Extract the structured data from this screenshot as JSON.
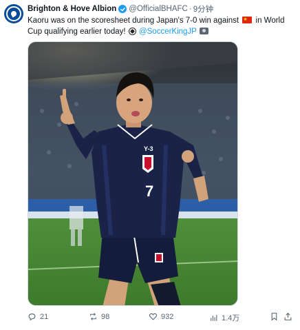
{
  "author": {
    "name": "Brighton & Hove Albion",
    "handle": "@OfficialBHAFC",
    "separator": "·",
    "time": "9分钟",
    "verified": true,
    "avatar_color": "#0a4c9a"
  },
  "tweet": {
    "text_part1": "Kaoru was on the scoresheet during Japan's 7-0 win against ",
    "flag": "china-flag",
    "text_part2": " in World Cup qualifying earlier today! ",
    "emoji1": "soccer-ball",
    "mention": "@SoccerKingJP",
    "emoji2": "camera-with-flash",
    "media_shirt_text": "Y-3",
    "media_number": "7"
  },
  "actions": {
    "replies": "21",
    "reposts": "98",
    "likes": "932",
    "views": "1.4万"
  },
  "colors": {
    "accent": "#1d9bf0",
    "text": "#0f1419",
    "muted": "#536471"
  }
}
